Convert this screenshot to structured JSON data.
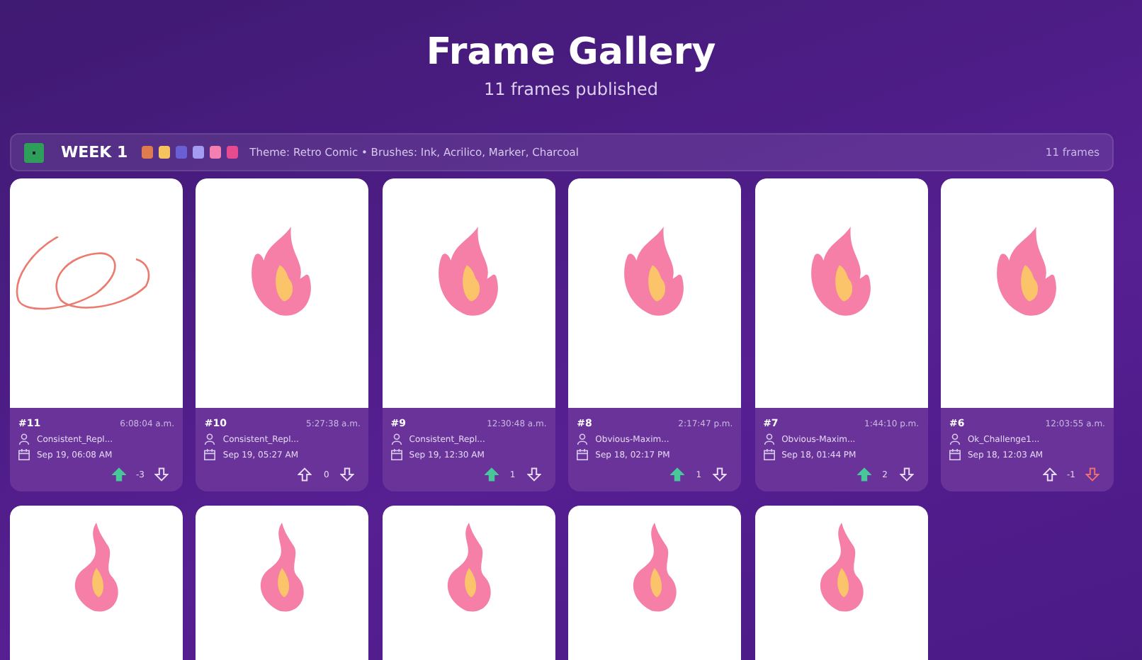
{
  "header": {
    "title": "Frame Gallery",
    "subtitle": "11 frames published"
  },
  "week": {
    "label": "WEEK 1",
    "palette": [
      {
        "color": "#e07b4f"
      },
      {
        "color": "#f7c35f"
      },
      {
        "color": "#6b5fd6"
      },
      {
        "color": "#a49cf2"
      },
      {
        "color": "#f57fb0"
      },
      {
        "color": "#e84a8f"
      }
    ],
    "theme": "Theme: Retro Comic • Brushes: Ink, Acrilico, Marker, Charcoal",
    "count": "11 frames"
  },
  "frames": [
    {
      "kind": "scribble",
      "number": "#11",
      "time": "6:08:04 a.m.",
      "author": "Consistent_Repl...",
      "date": "Sep 19, 06:08 AM",
      "upvoted": true,
      "score": "-3",
      "downvoted": false
    },
    {
      "kind": "flame",
      "number": "#10",
      "time": "5:27:38 a.m.",
      "author": "Consistent_Repl...",
      "date": "Sep 19, 05:27 AM",
      "upvoted": false,
      "score": "0",
      "downvoted": false
    },
    {
      "kind": "flame",
      "number": "#9",
      "time": "12:30:48 a.m.",
      "author": "Consistent_Repl...",
      "date": "Sep 19, 12:30 AM",
      "upvoted": true,
      "score": "1",
      "downvoted": false
    },
    {
      "kind": "flame",
      "number": "#8",
      "time": "2:17:47 p.m.",
      "author": "Obvious-Maxim...",
      "date": "Sep 18, 02:17 PM",
      "upvoted": true,
      "score": "1",
      "downvoted": false
    },
    {
      "kind": "flame",
      "number": "#7",
      "time": "1:44:10 p.m.",
      "author": "Obvious-Maxim...",
      "date": "Sep 18, 01:44 PM",
      "upvoted": true,
      "score": "2",
      "downvoted": false
    },
    {
      "kind": "flame",
      "number": "#6",
      "time": "12:03:55 a.m.",
      "author": "Ok_Challenge1...",
      "date": "Sep 18, 12:03 AM",
      "upvoted": false,
      "score": "-1",
      "downvoted": true
    }
  ],
  "more_frames": [
    {
      "kind": "flame"
    },
    {
      "kind": "flame"
    },
    {
      "kind": "flame"
    },
    {
      "kind": "flame"
    },
    {
      "kind": "flame"
    }
  ]
}
